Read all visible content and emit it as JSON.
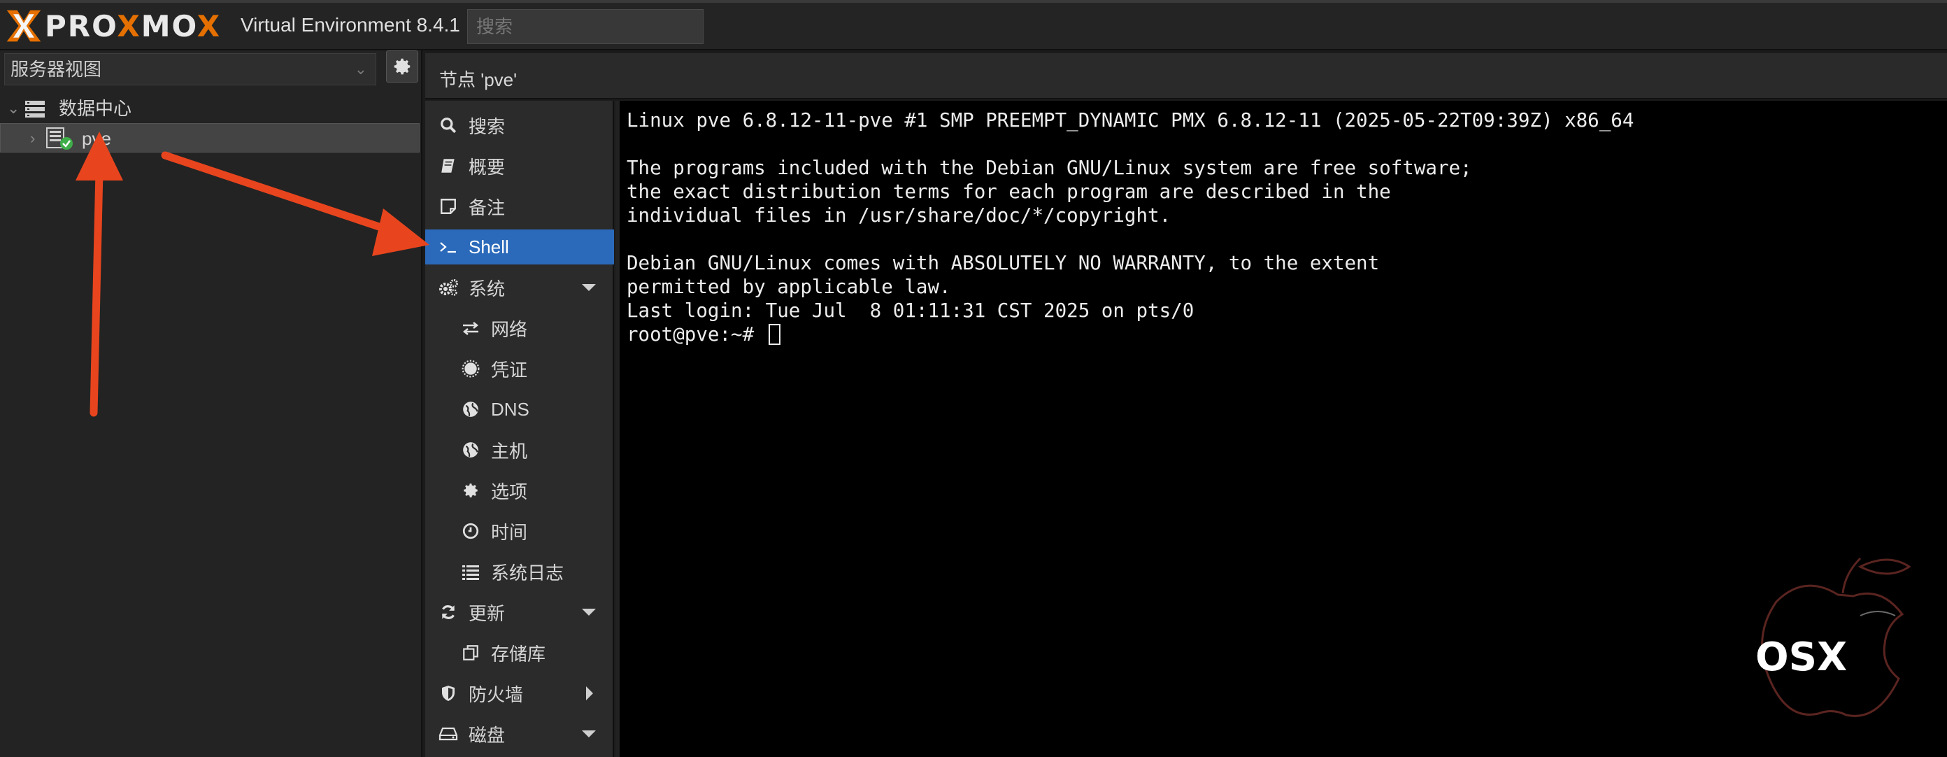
{
  "topbar": {
    "logo_text": "PROXMOX",
    "product_title": "Virtual Environment 8.4.1",
    "search_placeholder": "搜索"
  },
  "left_panel": {
    "view_select": "服务器视图",
    "tree": [
      {
        "label": "数据中心",
        "icon": "datacenter-icon"
      },
      {
        "label": "pve",
        "icon": "server-online-icon",
        "selected": true
      }
    ]
  },
  "breadcrumb": "节点 'pve'",
  "nav": {
    "items": [
      {
        "label": "搜索",
        "icon": "search-icon"
      },
      {
        "label": "概要",
        "icon": "book-icon"
      },
      {
        "label": "备注",
        "icon": "note-icon"
      },
      {
        "label": "Shell",
        "icon": "terminal-icon",
        "active": true
      },
      {
        "label": "系统",
        "icon": "cogs-icon",
        "caret": "down"
      },
      {
        "label": "网络",
        "icon": "exchange-icon",
        "sub": true
      },
      {
        "label": "凭证",
        "icon": "certificate-icon",
        "sub": true
      },
      {
        "label": "DNS",
        "icon": "globe-icon",
        "sub": true
      },
      {
        "label": "主机",
        "icon": "globe-icon",
        "sub": true
      },
      {
        "label": "选项",
        "icon": "gear-icon",
        "sub": true
      },
      {
        "label": "时间",
        "icon": "clock-icon",
        "sub": true
      },
      {
        "label": "系统日志",
        "icon": "list-icon",
        "sub": true
      },
      {
        "label": "更新",
        "icon": "refresh-icon",
        "caret": "down"
      },
      {
        "label": "存储库",
        "icon": "repository-icon",
        "sub": true
      },
      {
        "label": "防火墙",
        "icon": "shield-icon",
        "caret": "right"
      },
      {
        "label": "磁盘",
        "icon": "disk-icon",
        "caret": "down"
      }
    ]
  },
  "terminal": {
    "lines": [
      "Linux pve 6.8.12-11-pve #1 SMP PREEMPT_DYNAMIC PMX 6.8.12-11 (2025-05-22T09:39Z) x86_64",
      "",
      "The programs included with the Debian GNU/Linux system are free software;",
      "the exact distribution terms for each program are described in the",
      "individual files in /usr/share/doc/*/copyright.",
      "",
      "Debian GNU/Linux comes with ABSOLUTELY NO WARRANTY, to the extent",
      "permitted by applicable law.",
      "Last login: Tue Jul  8 01:11:31 CST 2025 on pts/0",
      "root@pve:~# "
    ]
  },
  "watermark": {
    "text": "OSX"
  },
  "colors": {
    "accent": "#2b6aba",
    "logo_orange": "#e57000",
    "annotation_arrow": "#e8451e",
    "status_ok": "#3fae49"
  }
}
